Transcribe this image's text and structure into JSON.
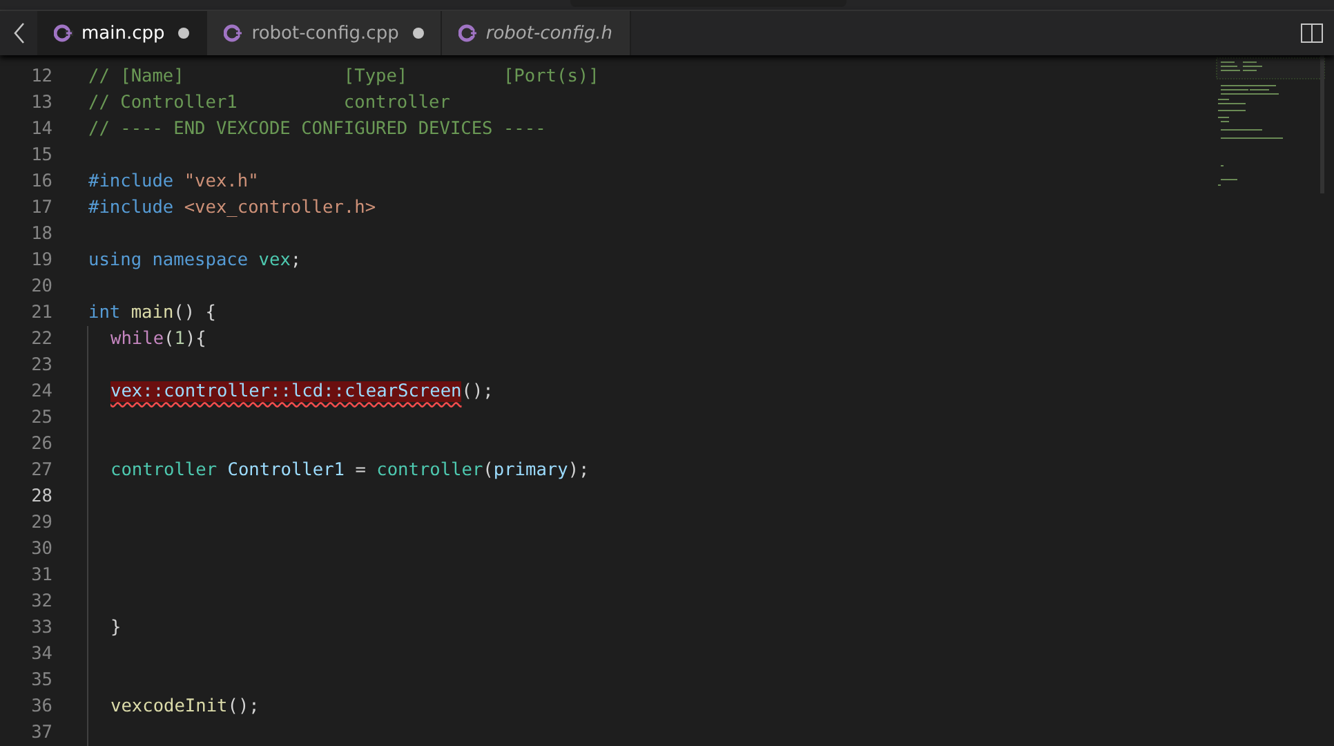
{
  "tabs": [
    {
      "label": "main.cpp",
      "selected": true,
      "modified": true,
      "preview": false
    },
    {
      "label": "robot-config.cpp",
      "selected": false,
      "modified": true,
      "preview": false
    },
    {
      "label": "robot-config.h",
      "selected": false,
      "modified": false,
      "preview": true
    }
  ],
  "editor": {
    "lines": [
      {
        "number": "12",
        "current": false,
        "indented": false,
        "tokens": [
          {
            "text": "// [Name]               [Type]         [Port(s)]",
            "kind": "comment"
          }
        ]
      },
      {
        "number": "13",
        "current": false,
        "indented": false,
        "tokens": [
          {
            "text": "// Controller1          controller",
            "kind": "comment"
          }
        ]
      },
      {
        "number": "14",
        "current": false,
        "indented": false,
        "tokens": [
          {
            "text": "// ---- END VEXCODE CONFIGURED DEVICES ----",
            "kind": "comment"
          }
        ]
      },
      {
        "number": "15",
        "current": false,
        "indented": false
      },
      {
        "number": "16",
        "current": false,
        "indented": false,
        "tokens": [
          {
            "text": "#include ",
            "kind": "keyword"
          },
          {
            "text": "\"vex.h\"",
            "kind": "string"
          }
        ]
      },
      {
        "number": "17",
        "current": false,
        "indented": false,
        "tokens": [
          {
            "text": "#include ",
            "kind": "keyword"
          },
          {
            "text": "<vex_controller.h>",
            "kind": "string"
          }
        ]
      },
      {
        "number": "18",
        "current": false,
        "indented": false
      },
      {
        "number": "19",
        "current": false,
        "indented": false,
        "tokens": [
          {
            "text": "using namespace ",
            "kind": "keyword"
          },
          {
            "text": "vex",
            "kind": "type"
          },
          {
            "text": ";",
            "kind": "plain"
          }
        ]
      },
      {
        "number": "20",
        "current": false,
        "indented": false
      },
      {
        "number": "21",
        "current": false,
        "indented": false,
        "tokens": [
          {
            "text": "int ",
            "kind": "keyword"
          },
          {
            "text": "main",
            "kind": "func"
          },
          {
            "text": "() {",
            "kind": "plain"
          }
        ]
      },
      {
        "number": "22",
        "current": false,
        "indented": true,
        "tokens": [
          {
            "text": "while",
            "kind": "control"
          },
          {
            "text": "(",
            "kind": "plain"
          },
          {
            "text": "1",
            "kind": "number"
          },
          {
            "text": "){",
            "kind": "plain"
          }
        ]
      },
      {
        "number": "23",
        "current": false,
        "indented": true
      },
      {
        "number": "24",
        "current": false,
        "indented": true,
        "tokens": [
          {
            "text": "vex::controller::lcd::clearScreen",
            "kind": "error"
          },
          {
            "text": "();",
            "kind": "plain"
          }
        ]
      },
      {
        "number": "25",
        "current": false,
        "indented": true
      },
      {
        "number": "26",
        "current": false,
        "indented": true
      },
      {
        "number": "27",
        "current": false,
        "indented": true,
        "tokens": [
          {
            "text": "controller ",
            "kind": "type"
          },
          {
            "text": "Controller1",
            "kind": "var"
          },
          {
            "text": " = ",
            "kind": "plain"
          },
          {
            "text": "controller",
            "kind": "type"
          },
          {
            "text": "(",
            "kind": "plain"
          },
          {
            "text": "primary",
            "kind": "var"
          },
          {
            "text": ");",
            "kind": "plain"
          }
        ]
      },
      {
        "number": "28",
        "current": true,
        "indented": true
      },
      {
        "number": "29",
        "current": false,
        "indented": true
      },
      {
        "number": "30",
        "current": false,
        "indented": true
      },
      {
        "number": "31",
        "current": false,
        "indented": true
      },
      {
        "number": "32",
        "current": false,
        "indented": true
      },
      {
        "number": "33",
        "current": false,
        "indented": true,
        "tokens": [
          {
            "text": "}",
            "kind": "plain"
          }
        ]
      },
      {
        "number": "34",
        "current": false,
        "indented": true
      },
      {
        "number": "35",
        "current": false,
        "indented": true
      },
      {
        "number": "36",
        "current": false,
        "indented": true,
        "tokens": [
          {
            "text": "vexcodeInit",
            "kind": "func"
          },
          {
            "text": "();",
            "kind": "plain"
          }
        ]
      },
      {
        "number": "37",
        "current": false,
        "indented": true
      }
    ]
  }
}
